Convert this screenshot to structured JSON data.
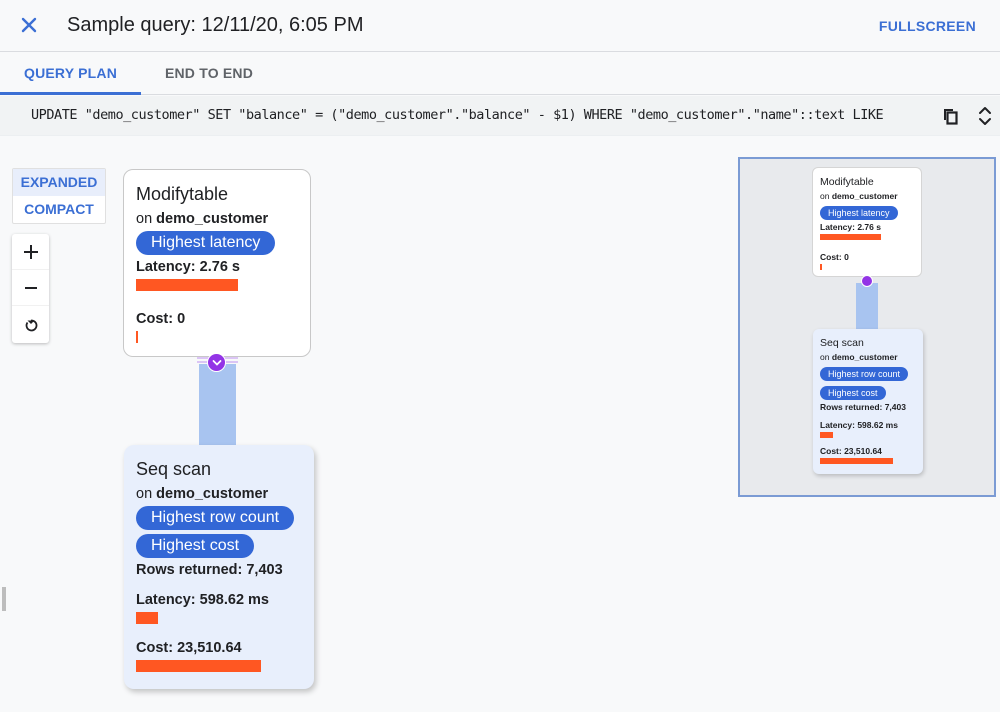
{
  "header": {
    "title": "Sample query: 12/11/20, 6:05 PM",
    "close_icon": "close-icon",
    "fullscreen_label": "FULLSCREEN"
  },
  "tabs": [
    {
      "label": "QUERY PLAN",
      "active": true
    },
    {
      "label": "END TO END",
      "active": false
    }
  ],
  "sql": {
    "text": "UPDATE \"demo_customer\" SET \"balance\" = (\"demo_customer\".\"balance\" - $1) WHERE \"demo_customer\".\"name\"::text LIKE",
    "copy_icon": "copy-icon",
    "expand_icon": "unfold-icon"
  },
  "view_toggle": {
    "options": [
      "EXPANDED",
      "COMPACT"
    ],
    "selected": "EXPANDED"
  },
  "zoom_controls": {
    "zoom_in": "zoom-in-icon",
    "zoom_out": "zoom-out-icon",
    "reset": "reset-icon"
  },
  "colors": {
    "accent": "#3b6fd4",
    "badge": "#3367d6",
    "bar": "#ff5722",
    "connector": "#a8c4f0",
    "collapse": "#9334e6"
  },
  "plan": {
    "nodes": [
      {
        "title": "Modifytable",
        "on_prefix": "on",
        "table": "demo_customer",
        "badges": [
          "Highest latency"
        ],
        "latency_label": "Latency: 2.76 s",
        "latency_fraction": 1.0,
        "cost_label": "Cost: 0",
        "cost_fraction": 0.0
      },
      {
        "title": "Seq scan",
        "on_prefix": "on",
        "table": "demo_customer",
        "badges": [
          "Highest row count",
          "Highest cost"
        ],
        "rows_label": "Rows returned: 7,403",
        "latency_label": "Latency: 598.62 ms",
        "latency_fraction": 0.22,
        "cost_label": "Cost: 23,510.64",
        "cost_fraction": 1.0
      }
    ]
  }
}
